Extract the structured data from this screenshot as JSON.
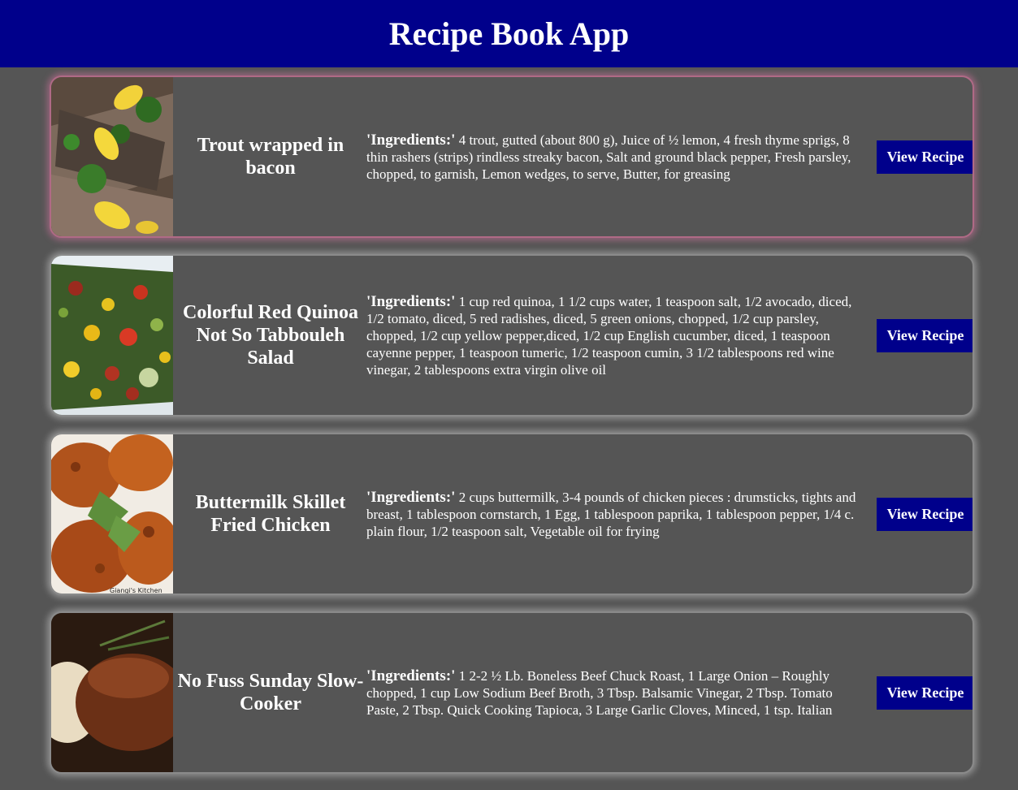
{
  "header": {
    "title": "Recipe Book App"
  },
  "ingredients_label": "'Ingredients:'",
  "view_button_label": "View Recipe",
  "recipes": [
    {
      "name": "Trout wrapped in bacon",
      "ingredients": "4 trout, gutted (about 800 g), Juice of ½ lemon, 4 fresh thyme sprigs, 8 thin rashers (strips) rindless streaky bacon, Salt and ground black pepper, Fresh parsley, chopped, to garnish, Lemon wedges, to serve, Butter, for greasing"
    },
    {
      "name": "Colorful Red Quinoa Not So Tabbouleh Salad",
      "ingredients": "1 cup red quinoa, 1 1/2 cups water, 1 teaspoon salt, 1/2 avocado, diced, 1/2 tomato, diced, 5 red radishes, diced, 5 green onions, chopped, 1/2 cup parsley, chopped, 1/2 cup yellow pepper,diced, 1/2 cup English cucumber, diced, 1 teaspoon cayenne pepper, 1 teaspoon tumeric, 1/2 teaspoon cumin, 3 1/2 tablespoons red wine vinegar, 2 tablespoons extra virgin olive oil"
    },
    {
      "name": "Buttermilk Skillet Fried Chicken",
      "ingredients": "2 cups buttermilk, 3-4 pounds of chicken pieces : drumsticks, tights and breast, 1 tablespoon cornstarch, 1 Egg, 1 tablespoon paprika, 1 tablespoon pepper, 1/4 c. plain flour, 1/2 teaspoon salt, Vegetable oil for frying",
      "image_caption": "Giangi's Kitchen"
    },
    {
      "name": "No Fuss Sunday Slow-Cooker",
      "ingredients": "1 2-2 ½ Lb. Boneless Beef Chuck Roast, 1 Large Onion – Roughly chopped, 1 cup Low Sodium Beef Broth, 3 Tbsp. Balsamic Vinegar, 2 Tbsp. Tomato Paste, 2 Tbsp. Quick Cooking Tapioca, 3 Large Garlic Cloves, Minced, 1 tsp. Italian"
    }
  ]
}
